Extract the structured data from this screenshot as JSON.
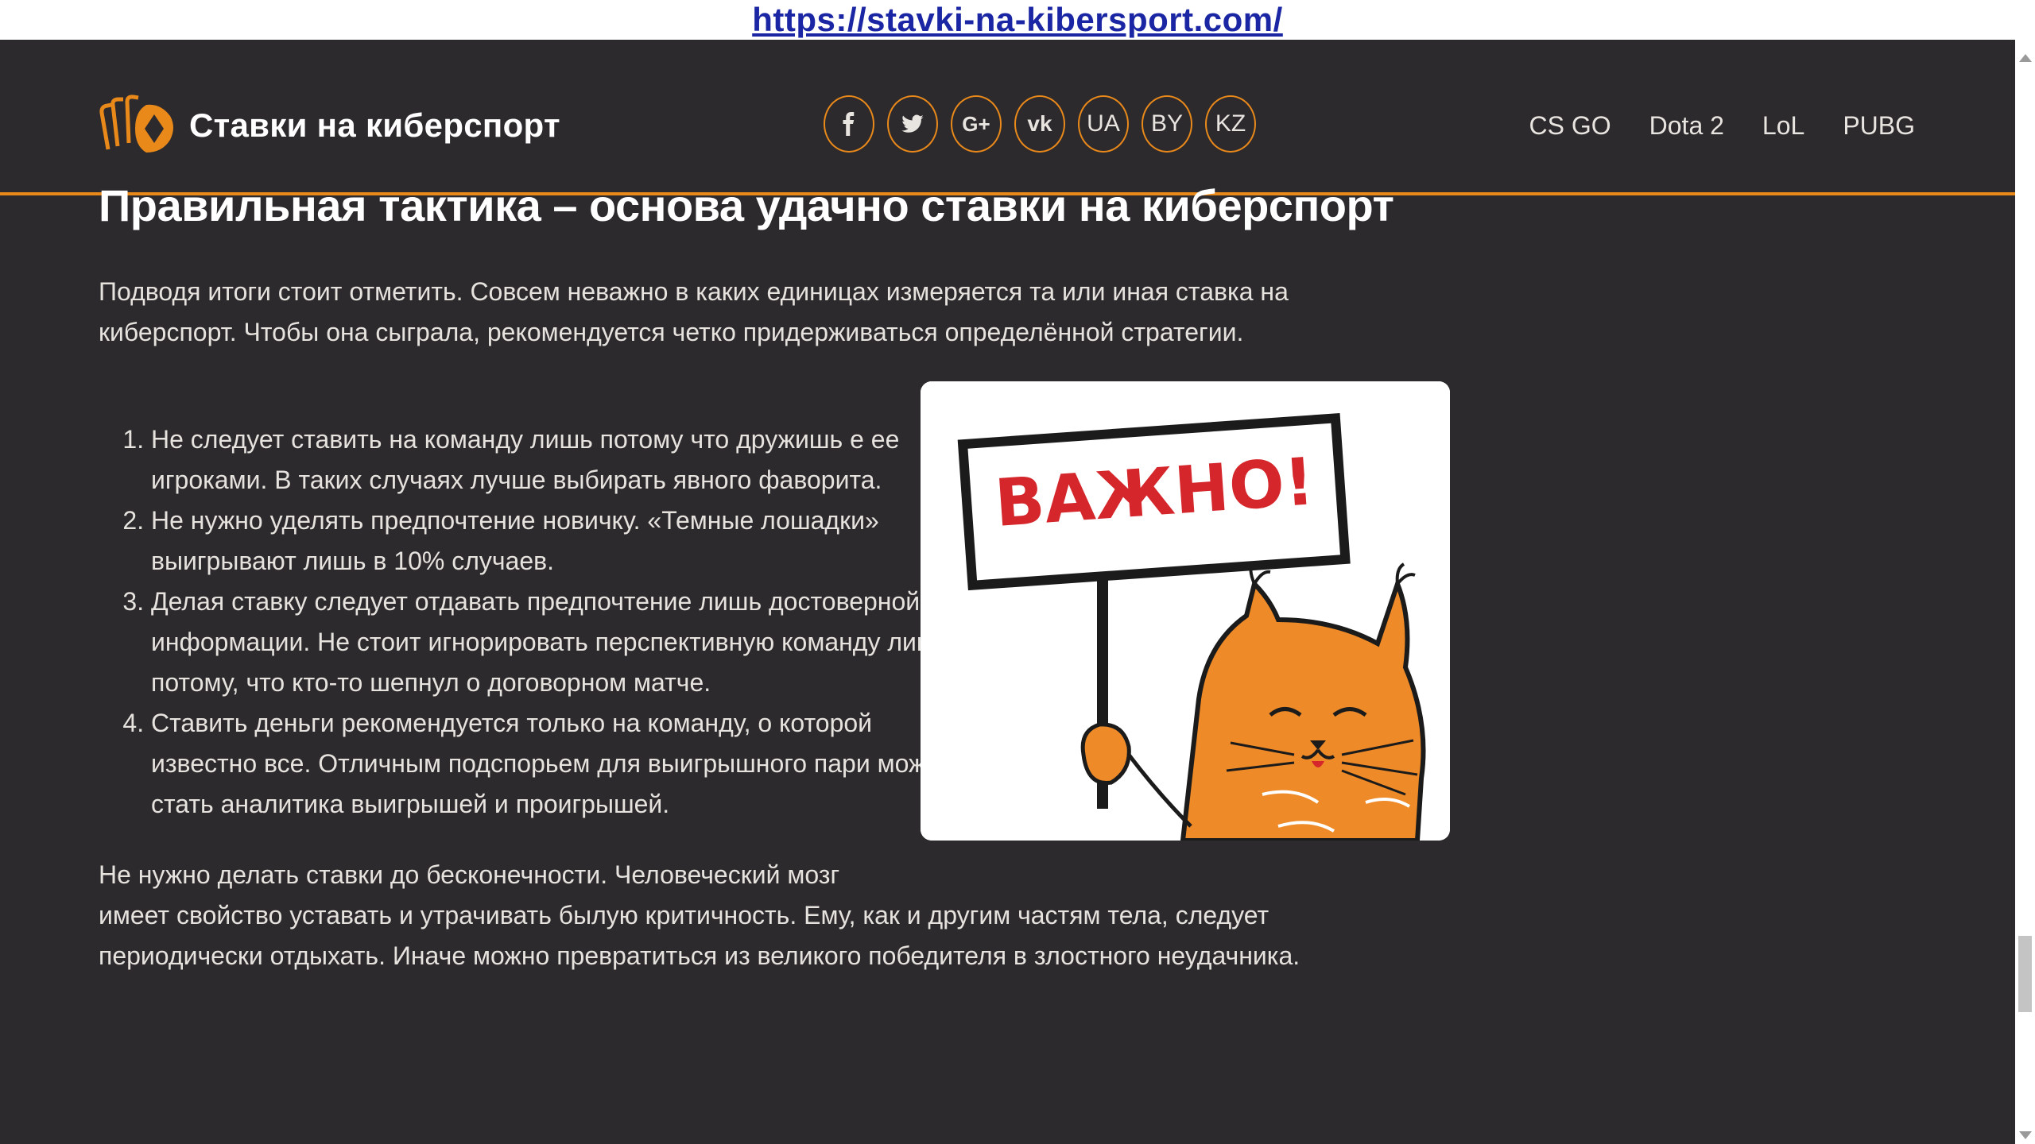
{
  "url": "https://stavki-na-kibersport.com/",
  "header": {
    "logo_text": "Ставки на киберспорт",
    "social": [
      {
        "name": "facebook",
        "label": "f"
      },
      {
        "name": "twitter",
        "label": ""
      },
      {
        "name": "google-plus",
        "label": "G+"
      },
      {
        "name": "vk",
        "label": "vk"
      },
      {
        "name": "ua",
        "label": "UA"
      },
      {
        "name": "by",
        "label": "BY"
      },
      {
        "name": "kz",
        "label": "KZ"
      }
    ],
    "nav": [
      "CS GO",
      "Dota 2",
      "LoL",
      "PUBG"
    ]
  },
  "article": {
    "title": "Правильная тактика – основа удачно ставки на киберспорт",
    "intro": "Подводя итоги стоит отметить. Совсем неважно в каких единицах измеряется та или иная ставка на киберспорт. Чтобы она сыграла, рекомендуется четко придерживаться определённой стратегии.",
    "list": [
      "Не следует ставить на команду лишь потому что дружишь е ее игроками. В таких случаях лучше выбирать явного фаворита.",
      "Не нужно уделять предпочтение новичку. «Темные лошадки» выигрывают лишь в 10% случаев.",
      "Делая ставку следует отдавать предпочтение лишь достоверной информации. Не стоит игнорировать перспективную команду лишь потому, что кто-то шепнул о договорном матче.",
      "Ставить деньги рекомендуется только на команду, о которой известно все. Отличным подспорьем для выигрышного пари может стать аналитика выигрышей и проигрышей."
    ],
    "image_sign_text": "ВАЖНО!",
    "outro_line1": "Не нужно делать ставки до бесконечности. Человеческий мозг",
    "outro_line2": "имеет свойство уставать и утрачивать былую критичность. Ему, как и другим частям тела, следует",
    "outro_line3": "периодически отдыхать. Иначе можно превратиться из великого победителя в злостного неудачника."
  },
  "colors": {
    "background": "#2d2a2e",
    "accent": "#e8891a",
    "text": "#e6e3df"
  }
}
